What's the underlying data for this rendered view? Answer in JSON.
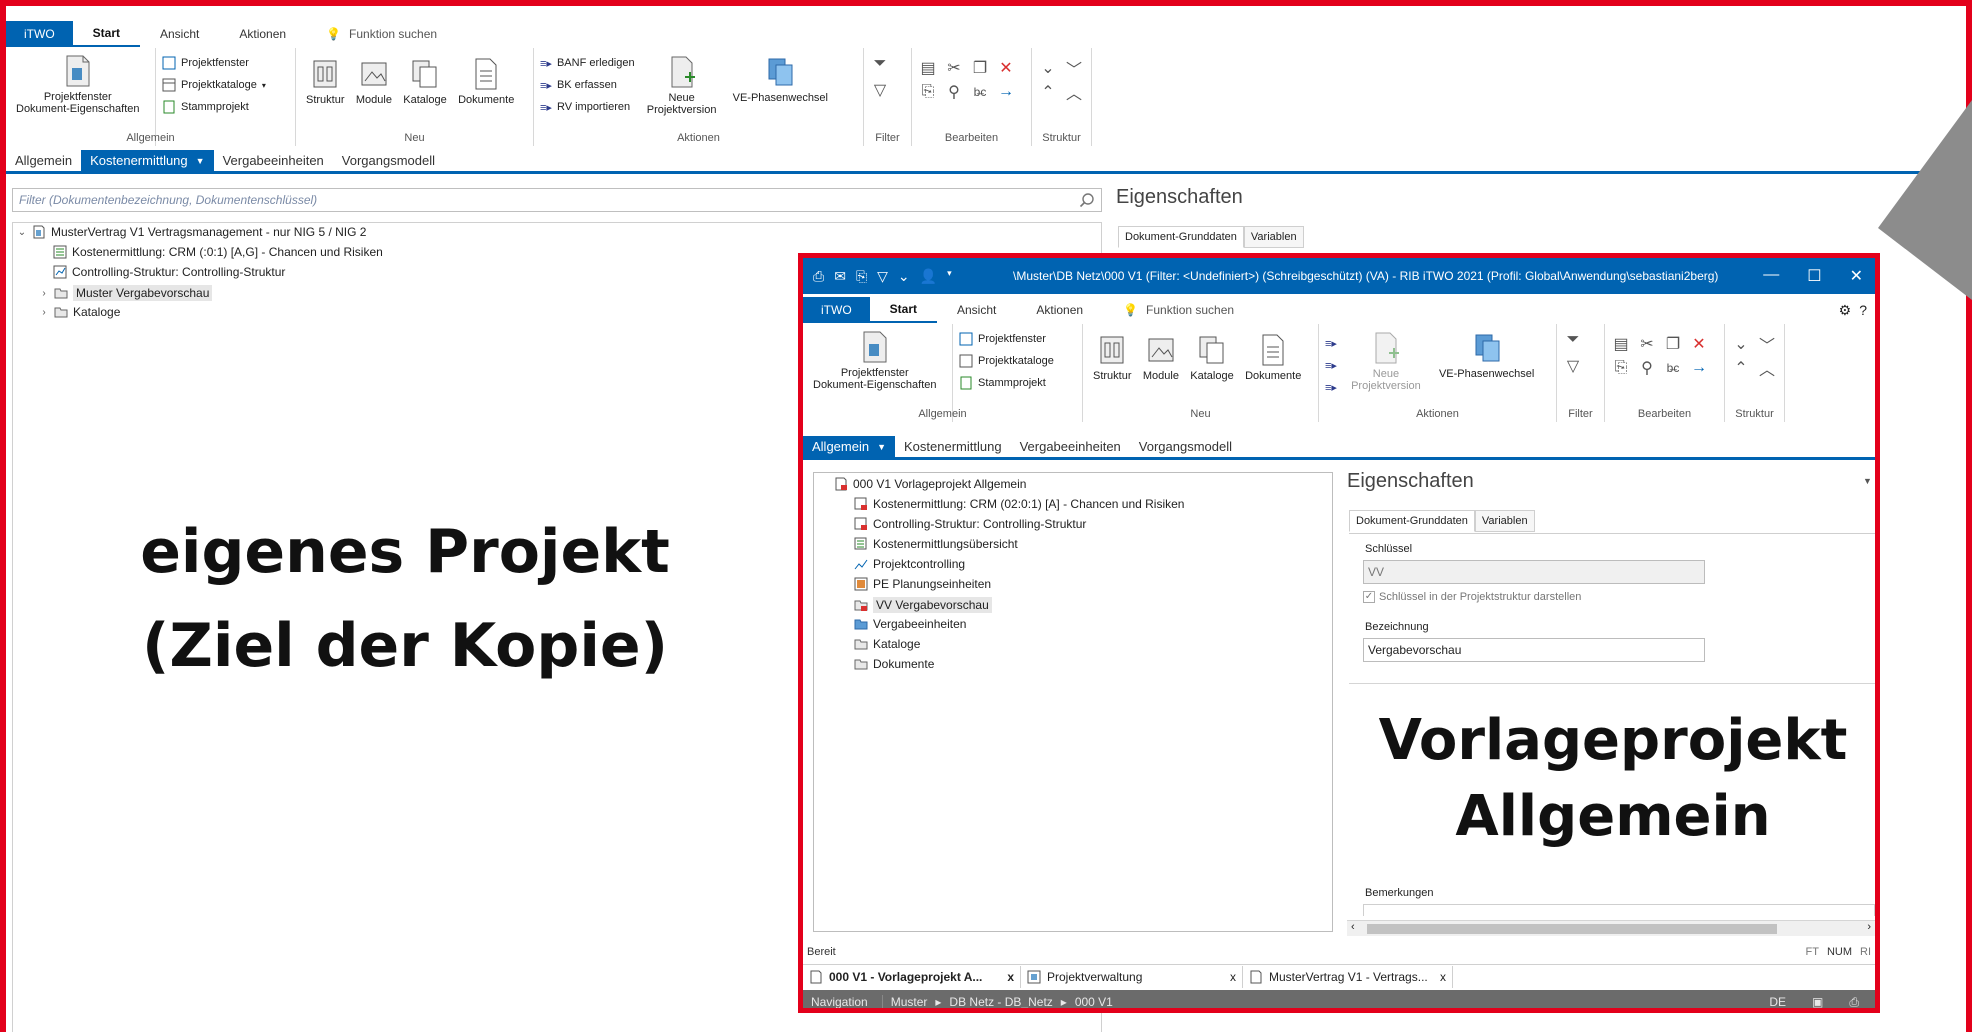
{
  "ribbon": {
    "tabs": [
      "iTWO",
      "Start",
      "Ansicht",
      "Aktionen"
    ],
    "search": "Funktion suchen",
    "groups": {
      "allgemein": {
        "label": "Allgemein",
        "big": "Projektfenster\nDokument-Eigenschaften",
        "small": [
          "Projektfenster",
          "Projektkataloge",
          "Stammprojekt"
        ]
      },
      "neu": {
        "label": "Neu",
        "buttons": [
          "Struktur",
          "Module",
          "Kataloge",
          "Dokumente"
        ]
      },
      "aktionen": {
        "label": "Aktionen",
        "small": [
          "BANF erledigen",
          "BK erfassen",
          "RV importieren"
        ],
        "big": [
          "Neue Projektversion",
          "VE-Phasenwechsel"
        ]
      },
      "filter": {
        "label": "Filter"
      },
      "bearbeiten": {
        "label": "Bearbeiten"
      },
      "struktur": {
        "label": "Struktur"
      }
    }
  },
  "nav_tabs": [
    "Allgemein",
    "Kostenermittlung",
    "Vergabeeinheiten",
    "Vorgangsmodell"
  ],
  "filter_placeholder": "Filter (Dokumentenbezeichnung, Dokumentenschlüssel)",
  "left_tree": [
    "MusterVertrag V1 Vertragsmanagement - nur NIG 5 / NIG 2",
    "Kostenermittlung: CRM (:0:1) [A,G]  - Chancen und Risiken",
    "Controlling-Struktur: Controlling-Struktur",
    "Muster Vergabevorschau",
    "Kataloge"
  ],
  "properties": {
    "title": "Eigenschaften",
    "tabs": [
      "Dokument-Grunddaten",
      "Variablen"
    ]
  },
  "overlay_left": [
    "eigenes Projekt",
    "(Ziel der Kopie)"
  ],
  "inner_window": {
    "caption": "\\Muster\\DB Netz\\000 V1 (Filter: <Undefiniert>) (Schreibgeschützt) (VA) - RIB iTWO 2021 (Profil: Global\\Anwendung\\sebastiani2berg)",
    "tree": [
      "000 V1 Vorlageprojekt Allgemein",
      "Kostenermittlung: CRM (02:0:1) [A]  - Chancen und Risiken",
      "Controlling-Struktur: Controlling-Struktur",
      "Kostenermittlungsübersicht",
      "Projektcontrolling",
      "PE Planungseinheiten",
      "VV Vergabevorschau",
      "Vergabeeinheiten",
      "Kataloge",
      "Dokumente"
    ],
    "fields": {
      "schluessel_label": "Schlüssel",
      "schluessel_value": "VV",
      "checkbox_label": "Schlüssel in der Projektstruktur darstellen",
      "bezeichnung_label": "Bezeichnung",
      "bezeichnung_value": "Vergabevorschau",
      "bemerkungen_label": "Bemerkungen"
    },
    "overlay": [
      "Vorlageprojekt",
      "Allgemein"
    ],
    "status": "Bereit",
    "status_right": [
      "FT",
      "NUM",
      "RI"
    ],
    "doc_tabs": [
      "000 V1 - Vorlageprojekt A...",
      "Projektverwaltung",
      "MusterVertrag V1 - Vertrags..."
    ],
    "nav": [
      "Navigation",
      "Muster",
      "DB Netz - DB_Netz",
      "000 V1"
    ],
    "nav_right": "DE"
  },
  "colors": {
    "accent": "#0063b1",
    "frame": "#e3001b"
  }
}
